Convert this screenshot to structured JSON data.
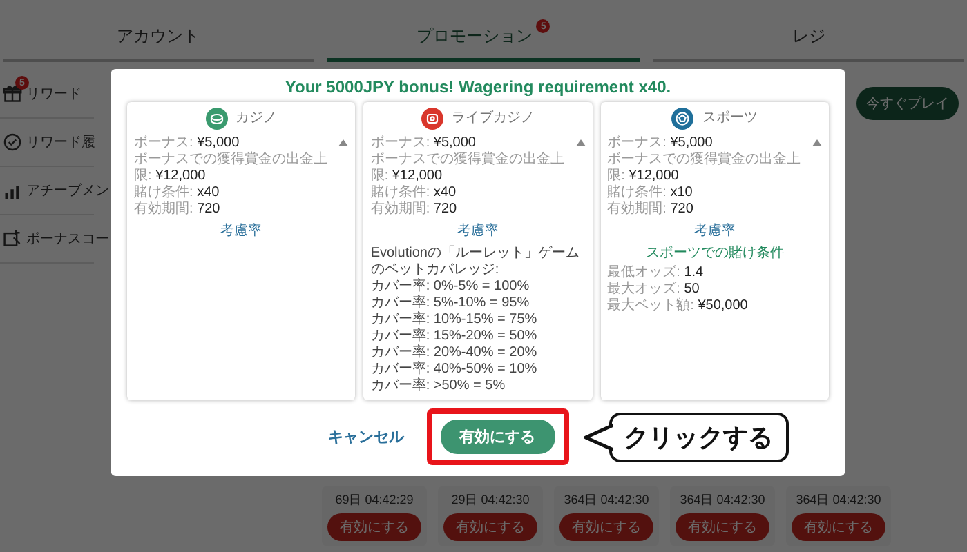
{
  "tabs": [
    {
      "label": "アカウント",
      "selected": false
    },
    {
      "label": "プロモーション",
      "selected": true,
      "badge": "5"
    },
    {
      "label": "レジ",
      "selected": false
    }
  ],
  "sidebar": {
    "items": [
      {
        "label": "リワード",
        "kind": "gift",
        "badge": "5"
      },
      {
        "label": "リワード履",
        "kind": "history"
      },
      {
        "label": "アチーブメン",
        "kind": "achievement"
      },
      {
        "label": "ボーナスコー",
        "kind": "code"
      }
    ]
  },
  "play_button": "今すぐプレイ",
  "promo_cards": [
    {
      "countdown": "69日 04:42:29",
      "button": "有効にする"
    },
    {
      "countdown": "29日 04:42:30",
      "button": "有効にする"
    },
    {
      "countdown": "364日 04:42:30",
      "button": "有効にする"
    },
    {
      "countdown": "364日 04:42:30",
      "button": "有効にする"
    },
    {
      "countdown": "364日 04:42:30",
      "button": "有効にする"
    }
  ],
  "modal": {
    "title": "Your 5000JPY bonus! Wagering requirement x40.",
    "cards": [
      {
        "kind": "casino",
        "title": "カジノ",
        "details": [
          {
            "label": "ボーナス:",
            "value": "¥5,000"
          },
          {
            "label": "ボーナスでの獲得賞金の出金上限:",
            "value": "¥12,000"
          },
          {
            "label": "賭け条件:",
            "value": "x40"
          },
          {
            "label": "有効期間:",
            "value": "720"
          }
        ],
        "link": "考慮率"
      },
      {
        "kind": "live",
        "title": "ライブカジノ",
        "details": [
          {
            "label": "ボーナス:",
            "value": "¥5,000"
          },
          {
            "label": "ボーナスでの獲得賞金の出金上限:",
            "value": "¥12,000"
          },
          {
            "label": "賭け条件:",
            "value": "x40"
          },
          {
            "label": "有効期間:",
            "value": "720"
          }
        ],
        "link": "考慮率",
        "lines": [
          "Evolutionの「ルーレット」ゲームのベットカバレッジ:",
          "カバー率: 0%-5% = 100%",
          "カバー率: 5%-10% = 95%",
          "カバー率: 10%-15% = 75%",
          "カバー率: 15%-20% = 50%",
          "カバー率: 20%-40% = 20%",
          "カバー率: 40%-50% = 10%",
          "カバー率: >50% = 5%"
        ]
      },
      {
        "kind": "sports",
        "title": "スポーツ",
        "details": [
          {
            "label": "ボーナス:",
            "value": "¥5,000"
          },
          {
            "label": "ボーナスでの獲得賞金の出金上限:",
            "value": "¥12,000"
          },
          {
            "label": "賭け条件:",
            "value": "x10"
          },
          {
            "label": "有効期間:",
            "value": "720"
          }
        ],
        "link": "考慮率",
        "section_title": "スポーツでの賭け条件",
        "section": [
          {
            "label": "最低オッズ:",
            "value": "1.4"
          },
          {
            "label": "最大オッズ:",
            "value": "50"
          },
          {
            "label": "最大ベット額:",
            "value": "¥50,000"
          }
        ]
      }
    ],
    "cancel": "キャンセル",
    "confirm": "有効にする"
  },
  "annotation": {
    "text": "クリックする"
  }
}
